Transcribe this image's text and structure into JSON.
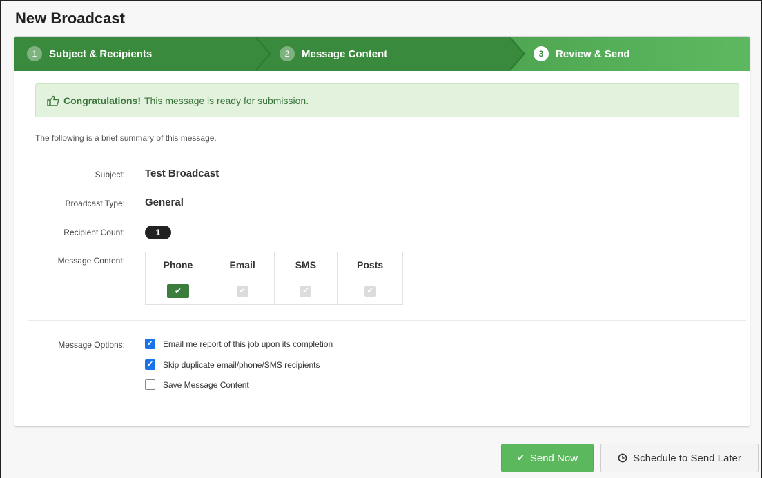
{
  "page": {
    "title": "New Broadcast"
  },
  "steps": [
    {
      "num": "1",
      "label": "Subject & Recipients"
    },
    {
      "num": "2",
      "label": "Message Content"
    },
    {
      "num": "3",
      "label": "Review & Send"
    }
  ],
  "alert": {
    "strong": "Congratulations!",
    "text": "This message is ready for submission."
  },
  "summary": {
    "intro": "The following is a brief summary of this message."
  },
  "fields": {
    "subject_label": "Subject:",
    "subject_value": "Test Broadcast",
    "type_label": "Broadcast Type:",
    "type_value": "General",
    "count_label": "Recipient Count:",
    "count_value": "1",
    "content_label": "Message Content:"
  },
  "content_table": {
    "headers": [
      "Phone",
      "Email",
      "SMS",
      "Posts"
    ],
    "enabled": [
      true,
      false,
      false,
      false
    ]
  },
  "options": {
    "label": "Message Options:",
    "items": [
      {
        "label": "Email me report of this job upon its completion",
        "checked": true
      },
      {
        "label": "Skip duplicate email/phone/SMS recipients",
        "checked": true
      },
      {
        "label": "Save Message Content",
        "checked": false
      }
    ]
  },
  "buttons": {
    "send_now": "Send Now",
    "schedule": "Schedule to Send Later"
  },
  "colors": {
    "wizard_green": "#3a8a3d",
    "send_green": "#5cb85c",
    "checkbox_blue": "#1a73e8"
  }
}
